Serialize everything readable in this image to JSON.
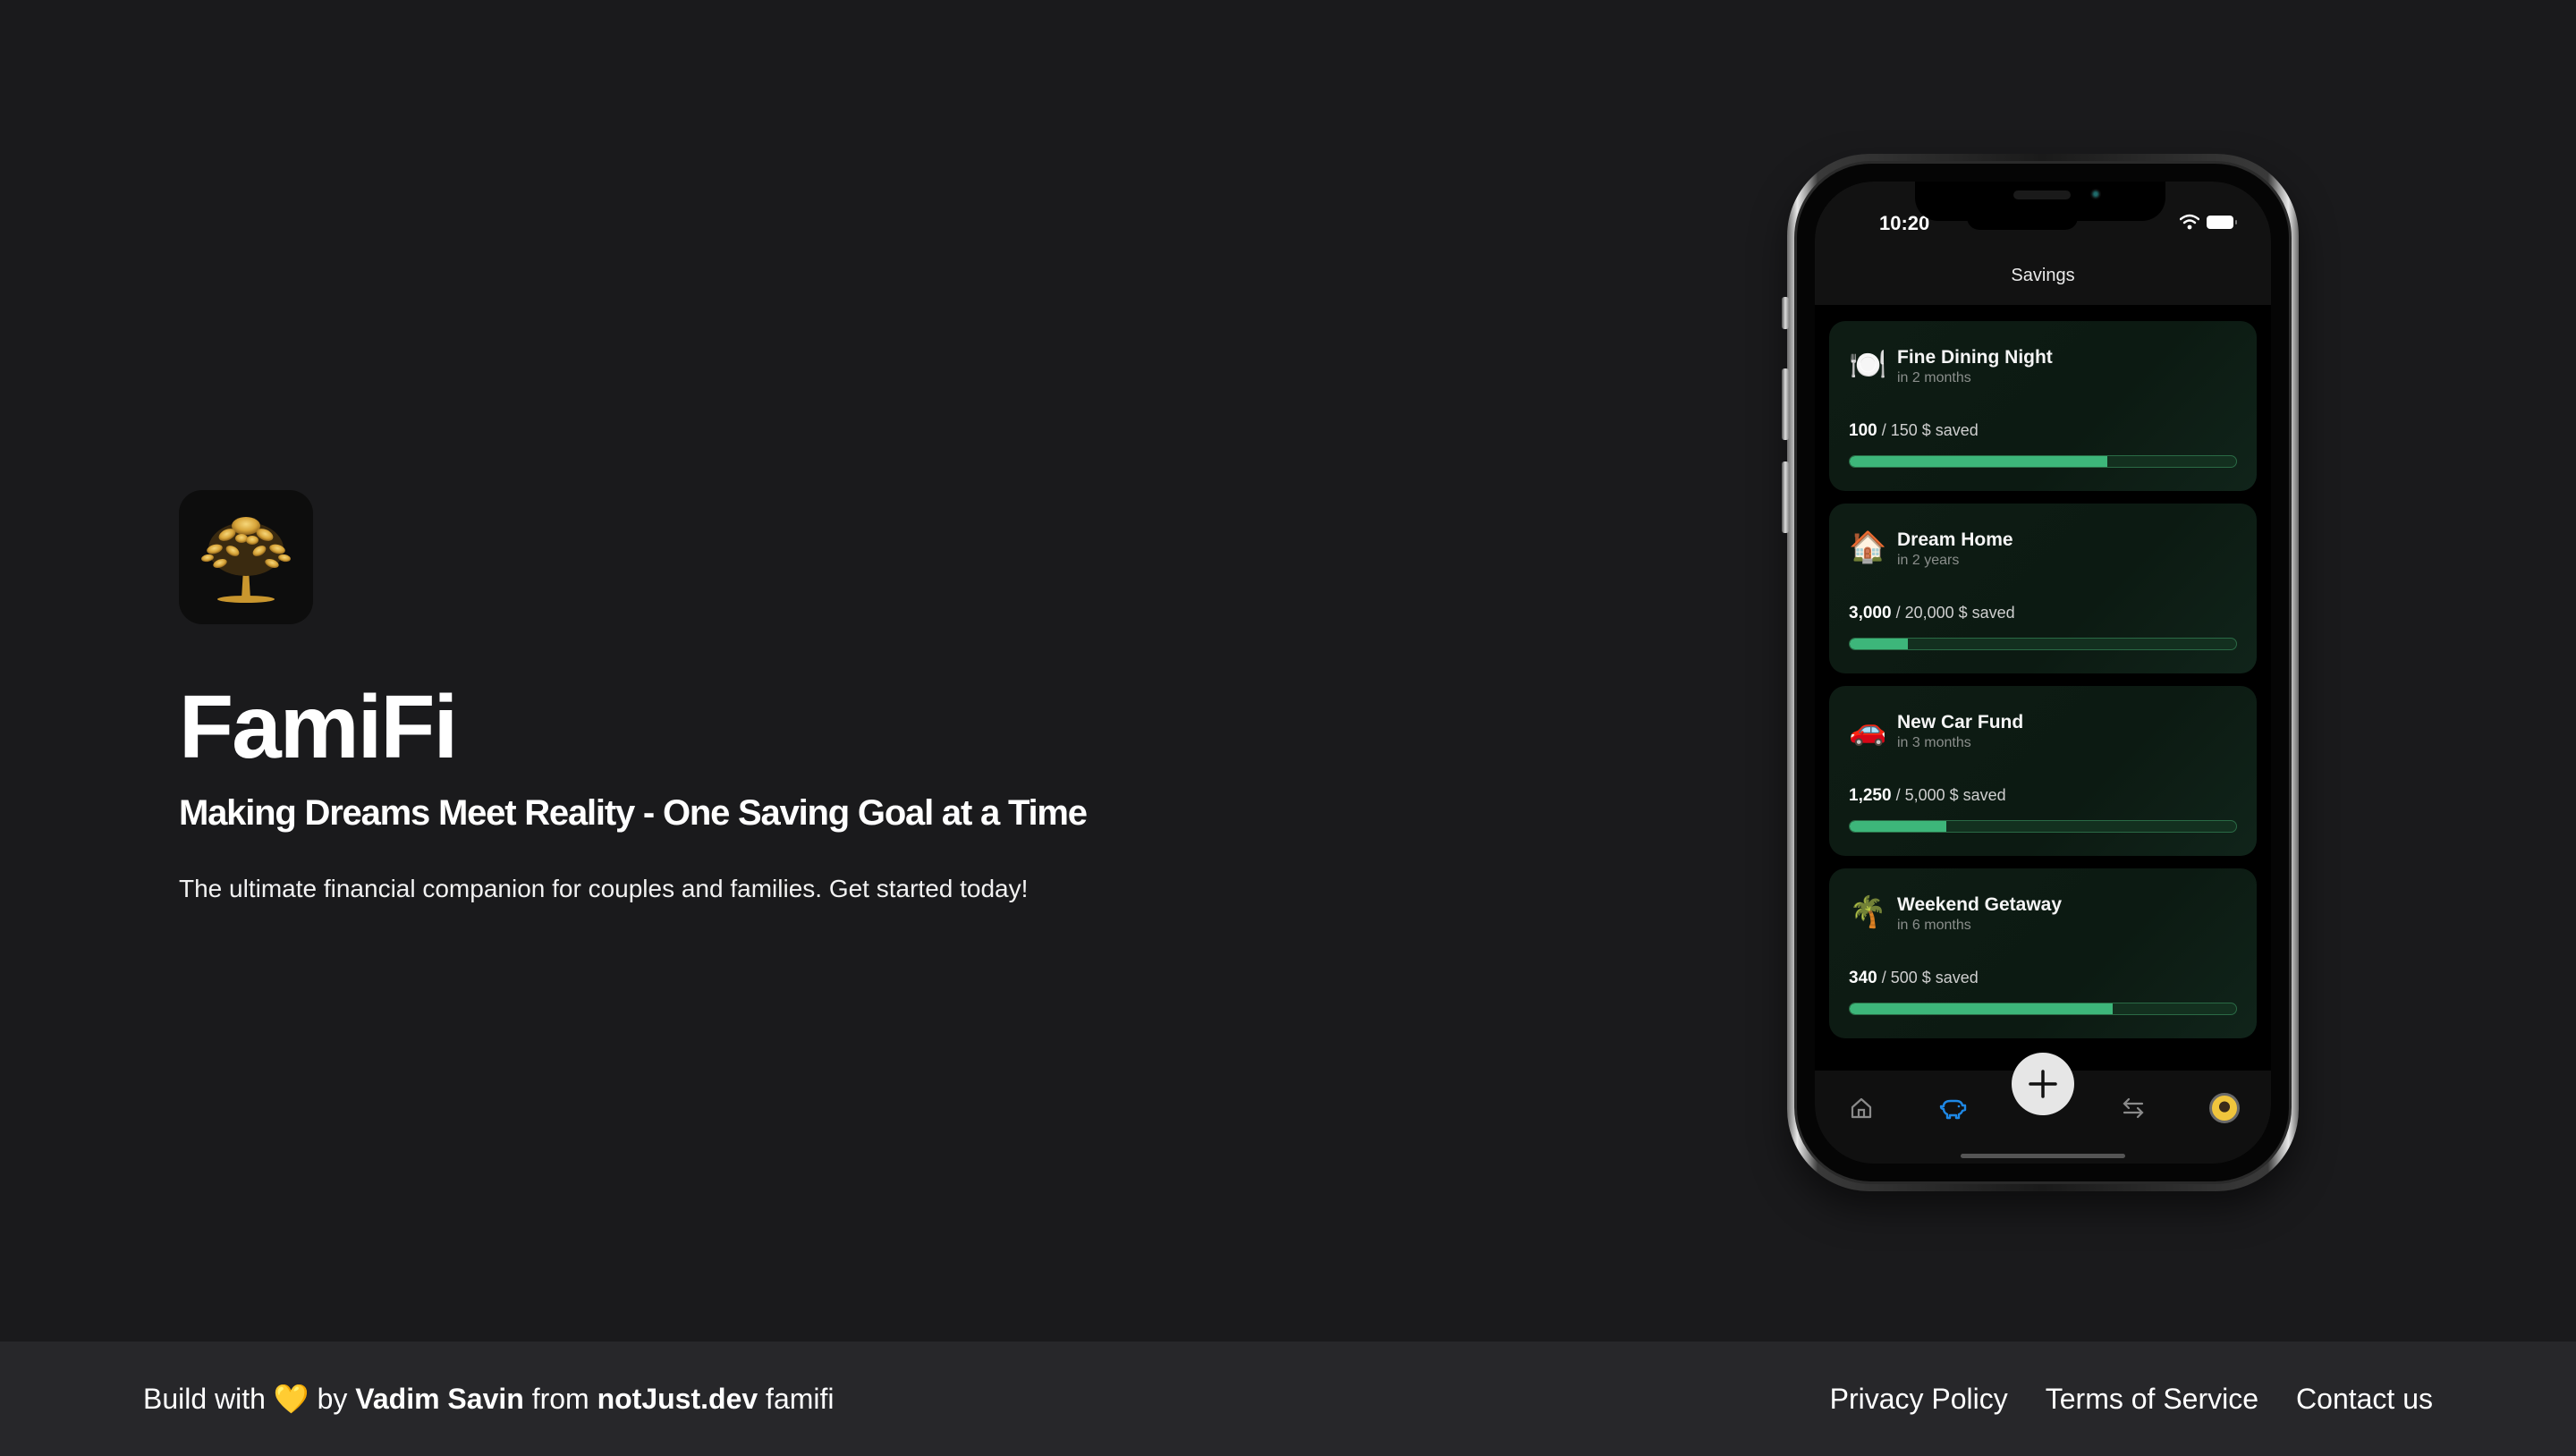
{
  "hero": {
    "app_icon": "golden-tree-icon",
    "title": "FamiFi",
    "tagline": "Making Dreams Meet Reality - One Saving Goal at a Time",
    "description": "The ultimate financial companion for couples and families. Get started today!"
  },
  "phone": {
    "status_time": "10:20",
    "screen_title": "Savings",
    "goals": [
      {
        "emoji": "🍽️",
        "icon": "plate-cutlery-icon",
        "title": "Fine Dining Night",
        "when": "in 2 months",
        "saved": "100",
        "target_text": "/ 150 $ saved",
        "progress": 0.667
      },
      {
        "emoji": "🏠",
        "icon": "house-icon",
        "title": "Dream Home",
        "when": "in 2 years",
        "saved": "3,000",
        "target_text": "/ 20,000 $ saved",
        "progress": 0.15
      },
      {
        "emoji": "🚗",
        "icon": "car-icon",
        "title": "New Car Fund",
        "when": "in 3 months",
        "saved": "1,250",
        "target_text": "/ 5,000 $ saved",
        "progress": 0.25
      },
      {
        "emoji": "🌴",
        "icon": "palm-tree-icon",
        "title": "Weekend Getaway",
        "when": "in 6 months",
        "saved": "340",
        "target_text": "/ 500 $ saved",
        "progress": 0.68
      }
    ],
    "tabs": [
      {
        "name": "home",
        "icon": "home-icon",
        "active": false
      },
      {
        "name": "savings",
        "icon": "piggy-bank-icon",
        "active": true
      },
      {
        "name": "add",
        "icon": "plus-icon",
        "active": false
      },
      {
        "name": "transactions",
        "icon": "transfer-arrows-icon",
        "active": false
      },
      {
        "name": "profile",
        "icon": "avatar",
        "active": false
      }
    ],
    "colors": {
      "progress_fill": "#3db67a",
      "progress_track": "#13301f",
      "active_tab": "#1e88e5",
      "card_bg": "#0e1c14"
    }
  },
  "footer": {
    "build_with": "Build with ",
    "heart": "💛",
    "by": " by ",
    "author": "Vadim Savin",
    "from": " from ",
    "org": "notJust.dev",
    "project": " famifi",
    "links": [
      "Privacy Policy",
      "Terms of Service",
      "Contact us"
    ]
  },
  "colors": {
    "page_bg": "#1a1a1c",
    "footer_bg": "#27272a",
    "text": "#ffffff"
  }
}
